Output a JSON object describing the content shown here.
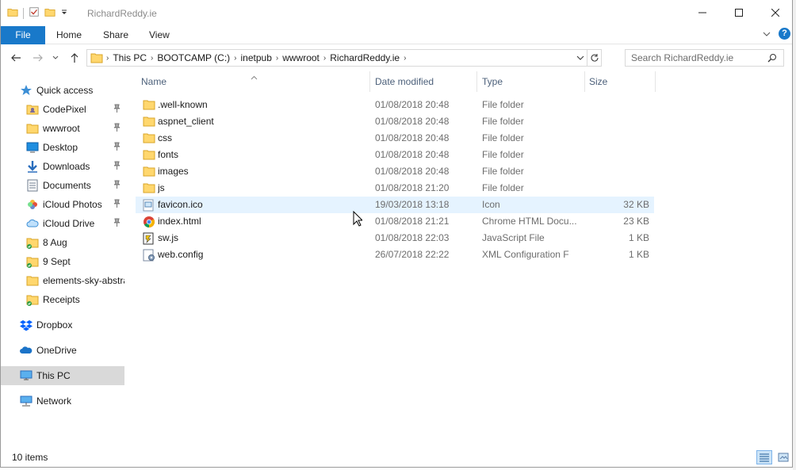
{
  "window": {
    "title": "RichardReddy.ie",
    "controls": {
      "minimize": "minimize-icon",
      "maximize": "maximize-icon",
      "close": "close-icon"
    }
  },
  "ribbon": {
    "tabs": [
      "File",
      "Home",
      "Share",
      "View"
    ],
    "accent": "#1979ca",
    "help_label": "?"
  },
  "address_bar": {
    "crumbs": [
      "This PC",
      "BOOTCAMP (C:)",
      "inetpub",
      "wwwroot",
      "RichardReddy.ie"
    ]
  },
  "search": {
    "placeholder": "Search RichardReddy.ie"
  },
  "sidebar": {
    "items": [
      {
        "label": "Quick access",
        "icon": "star-icon",
        "pinned": false,
        "level": 0
      },
      {
        "label": "CodePixel",
        "icon": "user-folder-icon",
        "pinned": true,
        "level": 1
      },
      {
        "label": "wwwroot",
        "icon": "folder-icon",
        "pinned": true,
        "level": 1
      },
      {
        "label": "Desktop",
        "icon": "desktop-icon",
        "pinned": true,
        "level": 1
      },
      {
        "label": "Downloads",
        "icon": "download-icon",
        "pinned": true,
        "level": 1
      },
      {
        "label": "Documents",
        "icon": "documents-icon",
        "pinned": true,
        "level": 1
      },
      {
        "label": "iCloud Photos",
        "icon": "icloud-photos-icon",
        "pinned": true,
        "level": 1
      },
      {
        "label": "iCloud Drive",
        "icon": "icloud-drive-icon",
        "pinned": true,
        "level": 1
      },
      {
        "label": "8 Aug",
        "icon": "synced-folder-icon",
        "pinned": false,
        "level": 1
      },
      {
        "label": "9 Sept",
        "icon": "synced-folder-icon",
        "pinned": false,
        "level": 1
      },
      {
        "label": "elements-sky-abstra",
        "icon": "folder-icon",
        "pinned": false,
        "level": 1
      },
      {
        "label": "Receipts",
        "icon": "synced-folder-icon",
        "pinned": false,
        "level": 1
      },
      {
        "label": "Dropbox",
        "icon": "dropbox-icon",
        "pinned": false,
        "level": 0
      },
      {
        "label": "OneDrive",
        "icon": "onedrive-icon",
        "pinned": false,
        "level": 0
      },
      {
        "label": "This PC",
        "icon": "computer-icon",
        "pinned": false,
        "level": 0,
        "selected": true
      },
      {
        "label": "Network",
        "icon": "network-icon",
        "pinned": false,
        "level": 0
      }
    ],
    "pin_glyph": "📌"
  },
  "file_list": {
    "columns": [
      "Name",
      "Date modified",
      "Type",
      "Size"
    ],
    "rows": [
      {
        "name": ".well-known",
        "date": "01/08/2018 20:48",
        "type": "File folder",
        "size": "",
        "icon": "folder-icon"
      },
      {
        "name": "aspnet_client",
        "date": "01/08/2018 20:48",
        "type": "File folder",
        "size": "",
        "icon": "folder-icon"
      },
      {
        "name": "css",
        "date": "01/08/2018 20:48",
        "type": "File folder",
        "size": "",
        "icon": "folder-icon"
      },
      {
        "name": "fonts",
        "date": "01/08/2018 20:48",
        "type": "File folder",
        "size": "",
        "icon": "folder-icon"
      },
      {
        "name": "images",
        "date": "01/08/2018 20:48",
        "type": "File folder",
        "size": "",
        "icon": "folder-icon"
      },
      {
        "name": "js",
        "date": "01/08/2018 21:20",
        "type": "File folder",
        "size": "",
        "icon": "folder-icon"
      },
      {
        "name": "favicon.ico",
        "date": "19/03/2018 13:18",
        "type": "Icon",
        "size": "32 KB",
        "icon": "ico-file-icon",
        "hover": true
      },
      {
        "name": "index.html",
        "date": "01/08/2018 21:21",
        "type": "Chrome HTML Docu...",
        "size": "23 KB",
        "icon": "chrome-icon"
      },
      {
        "name": "sw.js",
        "date": "01/08/2018 22:03",
        "type": "JavaScript File",
        "size": "1 KB",
        "icon": "js-file-icon"
      },
      {
        "name": "web.config",
        "date": "26/07/2018 22:22",
        "type": "XML Configuration F",
        "size": "1 KB",
        "icon": "config-file-icon"
      }
    ]
  },
  "status": {
    "item_count": "10 items"
  },
  "colors": {
    "folder": "#ffd76e",
    "hover_row": "#e5f3ff",
    "selected_nav": "#d9d9d9",
    "header_text": "#4c607a"
  }
}
